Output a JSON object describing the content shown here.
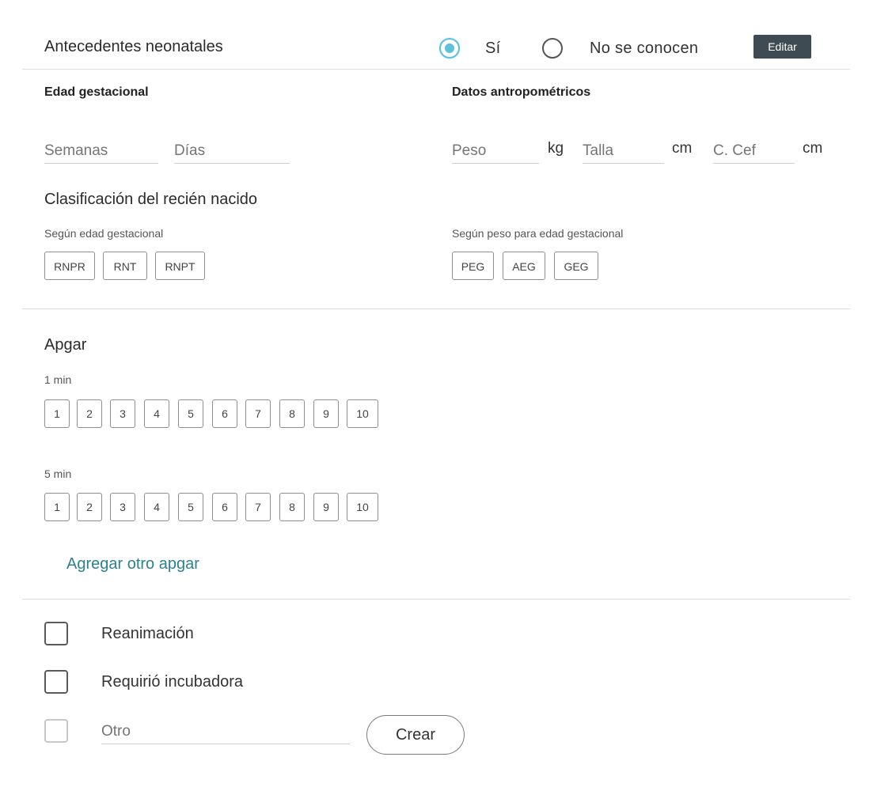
{
  "header": {
    "title": "Antecedentes neonatales",
    "radio_yes": "Sí",
    "radio_unknown": "No se conocen",
    "edit_button": "Editar"
  },
  "gestational_age": {
    "label": "Edad gestacional",
    "weeks_placeholder": "Semanas",
    "days_placeholder": "Días"
  },
  "anthropometric": {
    "label": "Datos antropométricos",
    "weight_placeholder": "Peso",
    "weight_unit": "kg",
    "height_placeholder": "Talla",
    "height_unit": "cm",
    "head_placeholder": "C. Cef",
    "head_unit": "cm"
  },
  "classification": {
    "title": "Clasificación del recién nacido",
    "by_age_label": "Según edad gestacional",
    "by_age_options": [
      "RNPR",
      "RNT",
      "RNPT"
    ],
    "by_weight_label": "Según peso para edad gestacional",
    "by_weight_options": [
      "PEG",
      "AEG",
      "GEG"
    ]
  },
  "apgar": {
    "title": "Apgar",
    "min1_label": "1 min",
    "min5_label": "5 min",
    "scores": [
      "1",
      "2",
      "3",
      "4",
      "5",
      "6",
      "7",
      "8",
      "9",
      "10"
    ],
    "add_link": "Agregar otro apgar"
  },
  "checks": {
    "reanimation": "Reanimación",
    "incubator": "Requirió incubadora",
    "other_placeholder": "Otro",
    "create_button": "Crear"
  }
}
